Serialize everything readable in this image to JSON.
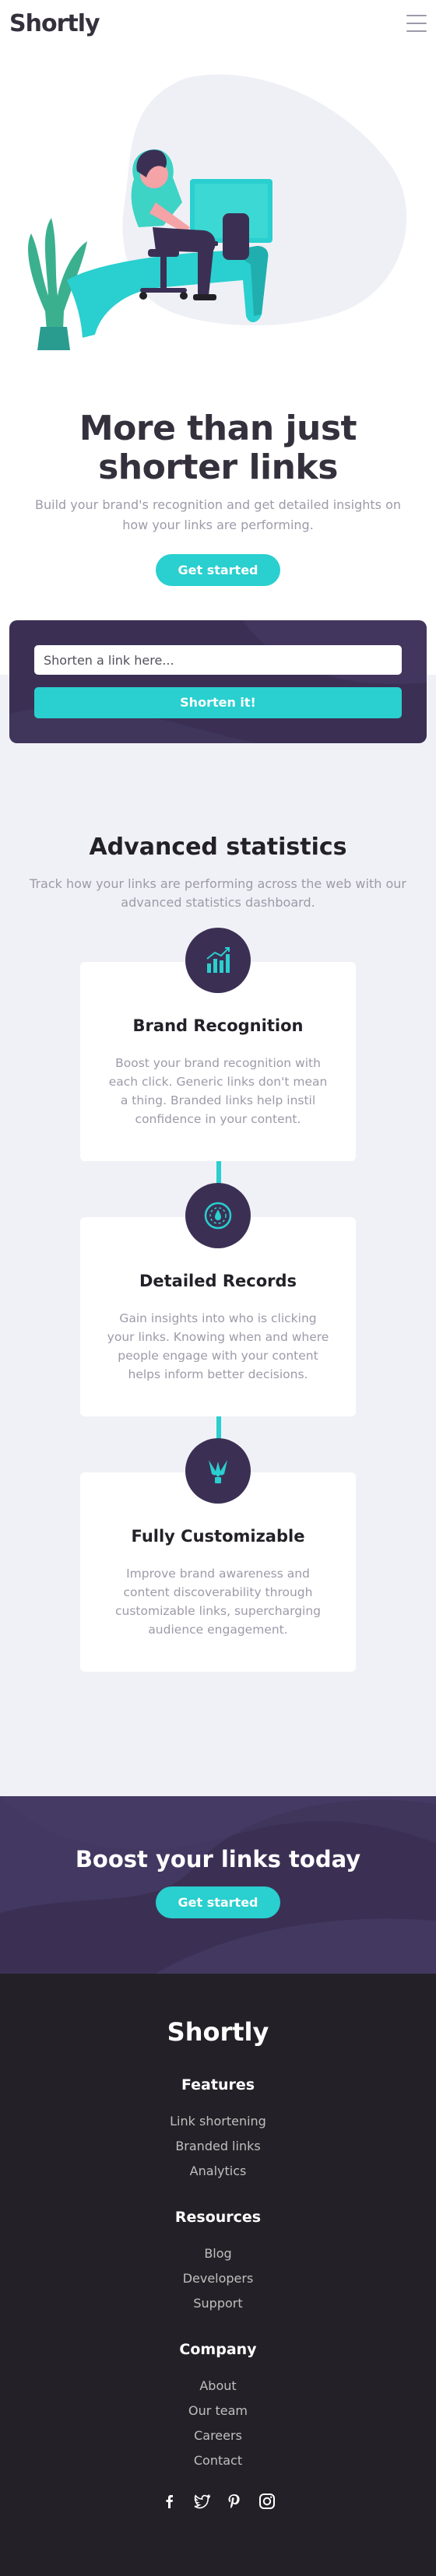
{
  "header": {
    "logo": "Shortly",
    "menu_icon": "hamburger-menu-icon"
  },
  "hero": {
    "illustration": "person-working-at-desk-illustration",
    "title": "More than just shorter links",
    "subtitle": "Build your brand's recognition and get detailed insights on how your links are performing.",
    "cta_label": "Get started"
  },
  "shorten": {
    "placeholder": "Shorten a link here...",
    "button_label": "Shorten it!"
  },
  "stats": {
    "title": "Advanced statistics",
    "subtitle": "Track how your links are performing across the web with our advanced statistics dashboard.",
    "cards": [
      {
        "icon": "bar-chart-icon",
        "title": "Brand Recognition",
        "text": "Boost your brand recognition with each click. Generic links don't mean a thing. Branded links help instil confidence in your content."
      },
      {
        "icon": "gauge-icon",
        "title": "Detailed Records",
        "text": "Gain insights into who is clicking your links. Knowing when and where people engage with your content helps inform better decisions."
      },
      {
        "icon": "pens-icon",
        "title": "Fully Customizable",
        "text": "Improve brand awareness and content discoverability through customizable links, supercharging audience engagement."
      }
    ]
  },
  "boost": {
    "title": "Boost your links today",
    "cta_label": "Get started"
  },
  "footer": {
    "logo": "Shortly",
    "groups": [
      {
        "heading": "Features",
        "links": [
          "Link shortening",
          "Branded links",
          "Analytics"
        ]
      },
      {
        "heading": "Resources",
        "links": [
          "Blog",
          "Developers",
          "Support"
        ]
      },
      {
        "heading": "Company",
        "links": [
          "About",
          "Our team",
          "Careers",
          "Contact"
        ]
      }
    ],
    "socials": [
      "facebook-icon",
      "twitter-icon",
      "pinterest-icon",
      "instagram-icon"
    ]
  },
  "colors": {
    "cyan": "#2acfcf",
    "dark_violet": "#3b3054",
    "very_dark_violet": "#232127",
    "gray": "#9e9aa8",
    "light_bg": "#f0f1f6"
  }
}
